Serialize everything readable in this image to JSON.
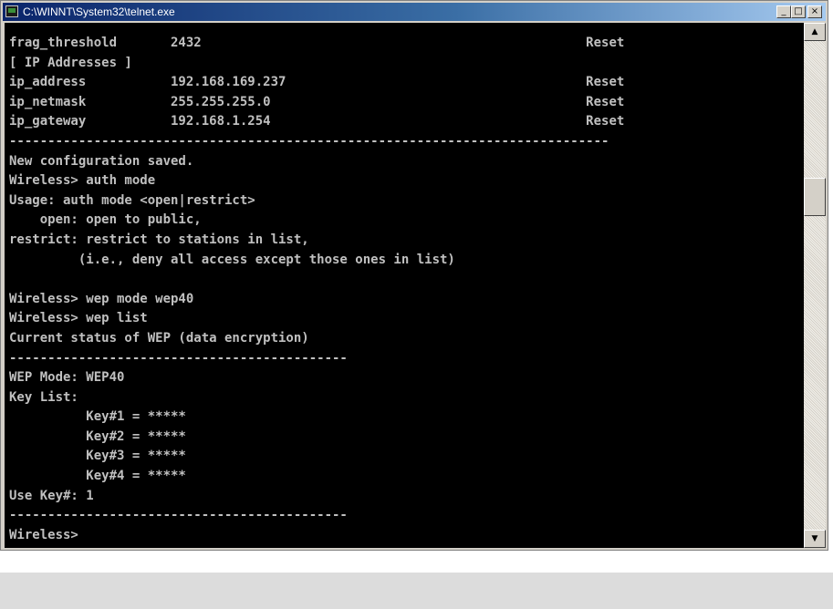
{
  "window": {
    "title": "C:\\WINNT\\System32\\telnet.exe",
    "buttons": {
      "minimize": "_",
      "maximize": "□",
      "close": "×"
    },
    "icon": "console-app-icon"
  },
  "console": {
    "lines": [
      "frag_threshold       2432                                                  Reset",
      "[ IP Addresses ]",
      "ip_address           192.168.169.237                                       Reset",
      "ip_netmask           255.255.255.0                                         Reset",
      "ip_gateway           192.168.1.254                                         Reset",
      "------------------------------------------------------------------------------",
      "New configuration saved.",
      "Wireless> auth mode",
      "Usage: auth mode <open|restrict>",
      "    open: open to public,",
      "restrict: restrict to stations in list,",
      "         (i.e., deny all access except those ones in list)",
      "",
      "Wireless> wep mode wep40",
      "Wireless> wep list",
      "Current status of WEP (data encryption)",
      "--------------------------------------------",
      "WEP Mode: WEP40",
      "Key List:",
      "          Key#1 = *****",
      "          Key#2 = *****",
      "          Key#3 = *****",
      "          Key#4 = *****",
      "Use Key#: 1",
      "--------------------------------------------",
      "Wireless>"
    ]
  },
  "scrollbar": {
    "up_arrow": "▲",
    "down_arrow": "▼"
  }
}
